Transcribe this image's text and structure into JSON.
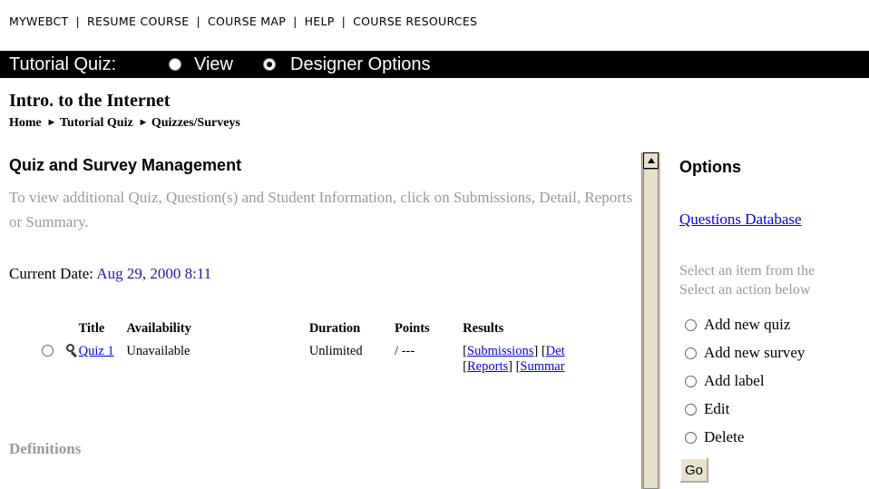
{
  "topnav": {
    "items": [
      "MYWEBCT",
      "RESUME COURSE",
      "COURSE MAP",
      "HELP",
      "COURSE RESOURCES"
    ]
  },
  "titlebar": {
    "label": "Tutorial Quiz:",
    "view_label": "View",
    "designer_label": "Designer Options",
    "selected": "Designer Options"
  },
  "course": {
    "title": "Intro. to the Internet",
    "breadcrumb": [
      "Home",
      "Tutorial Quiz",
      "Quizzes/Surveys"
    ]
  },
  "main": {
    "heading": "Quiz and Survey Management",
    "description": "To view additional Quiz, Question(s) and Student Information, click on Submissions, Detail, Reports or Summary.",
    "current_date_label": "Current Date:",
    "current_date_value": "Aug 29, 2000 8:11",
    "table": {
      "headers": [
        "Title",
        "Availability",
        "Duration",
        "Points",
        "Results"
      ],
      "rows": [
        {
          "title": "Quiz 1",
          "availability": "Unavailable",
          "duration": "Unlimited",
          "points": "/ ---",
          "results": [
            "Submissions",
            "Det",
            "Reports",
            "Summar"
          ]
        }
      ]
    },
    "definitions_label": "Definitions"
  },
  "sidebar": {
    "heading": "Options",
    "questions_db": "Questions Database",
    "hint1": "Select an item from the",
    "hint2": "Select an action below",
    "actions": [
      "Add new quiz",
      "Add new survey",
      "Add label",
      "Edit",
      "Delete"
    ],
    "go_label": "Go"
  }
}
